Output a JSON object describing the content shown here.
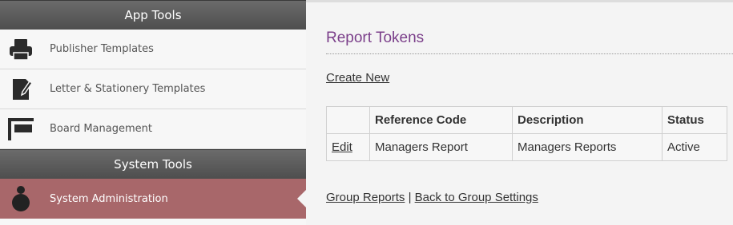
{
  "sidebar": {
    "app_tools_header": "App Tools",
    "app_items": [
      {
        "label": "Publisher Templates",
        "icon": "printer-icon"
      },
      {
        "label": "Letter & Stationery Templates",
        "icon": "letter-pen-icon"
      },
      {
        "label": "Board Management",
        "icon": "board-icon"
      }
    ],
    "system_tools_header": "System Tools",
    "system_items": [
      {
        "label": "System Administration",
        "icon": "admin-user-icon"
      }
    ]
  },
  "main": {
    "title": "Report Tokens",
    "create_new": "Create New",
    "table": {
      "headers": [
        "",
        "Reference Code",
        "Description",
        "Status"
      ],
      "rows": [
        {
          "action": "Edit",
          "reference_code": "Managers Report",
          "description": "Managers Reports",
          "status": "Active"
        }
      ]
    },
    "footer": {
      "group_reports": "Group Reports",
      "separator": "|",
      "back_to_group_settings": "Back to Group Settings"
    }
  },
  "colors": {
    "title": "#7b3f8a",
    "active_item": "#a8676a",
    "header_bg": "#5a5a5a"
  }
}
